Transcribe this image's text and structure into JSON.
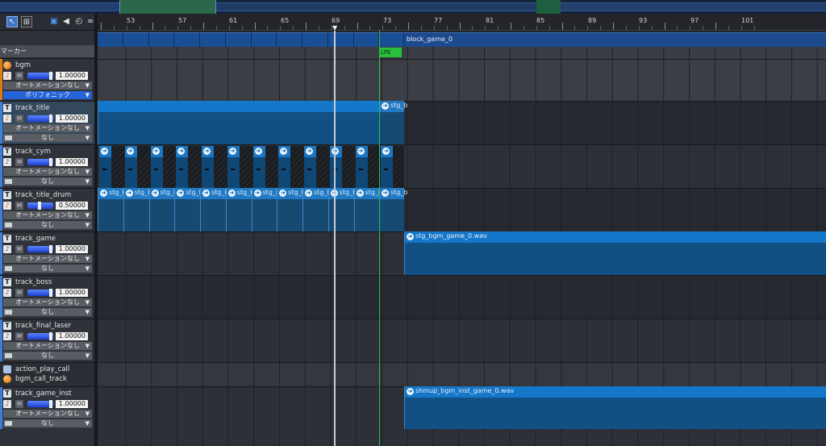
{
  "colors": {
    "clip_header": "#1577c9",
    "clip_body": "#124f83",
    "block": "#1b4f95",
    "marker_green": "#29c13c",
    "accent_orange": "#e07b12"
  },
  "toolbar": {
    "icons": [
      "pointer-icon",
      "grid-select-icon",
      "record-icon",
      "speaker-icon",
      "timer-icon",
      "link-icon"
    ]
  },
  "marker_label": "マーカー",
  "ruler": {
    "labels": [
      "53",
      "57",
      "61",
      "65",
      "69",
      "73",
      "77",
      "81",
      "85",
      "89",
      "93",
      "97",
      "101"
    ],
    "playhead_bar": "69"
  },
  "block": {
    "label": "block_game_0"
  },
  "lpe_marker": "LPE",
  "tracks": [
    {
      "name": "bgm",
      "volume": "1.00000",
      "automation": "オートメーションなし",
      "extra": "ポリフォニック"
    },
    {
      "name": "track_title",
      "volume": "1.00000",
      "automation": "オートメーションなし",
      "extra": "なし"
    },
    {
      "name": "track_cym",
      "volume": "1.00000",
      "automation": "オートメーションなし",
      "extra": "なし"
    },
    {
      "name": "track_title_drum",
      "volume": "0.50000",
      "automation": "オートメーションなし",
      "extra": "なし"
    },
    {
      "name": "track_game",
      "volume": "1.00000",
      "automation": "オートメーションなし",
      "extra": "なし"
    },
    {
      "name": "track_boss",
      "volume": "1.00000",
      "automation": "オートメーションなし",
      "extra": "なし"
    },
    {
      "name": "track_final_laser",
      "volume": "1.00000",
      "automation": "オートメーションなし",
      "extra": "なし"
    },
    {
      "name": "track_game_inst",
      "volume": "1.00000",
      "automation": "オートメーションなし",
      "extra": "なし"
    }
  ],
  "action_group": {
    "name": "action_play_call",
    "sub": "bgm_call_track"
  },
  "clips": {
    "title_next": "stg_b",
    "drum": "stg_bgm_title",
    "drum_next": "stg_b",
    "game": "stg_bgm_game_0.wav",
    "game_inst": "shmup_bgm_inst_game_0.wav"
  },
  "mute_label": "M"
}
